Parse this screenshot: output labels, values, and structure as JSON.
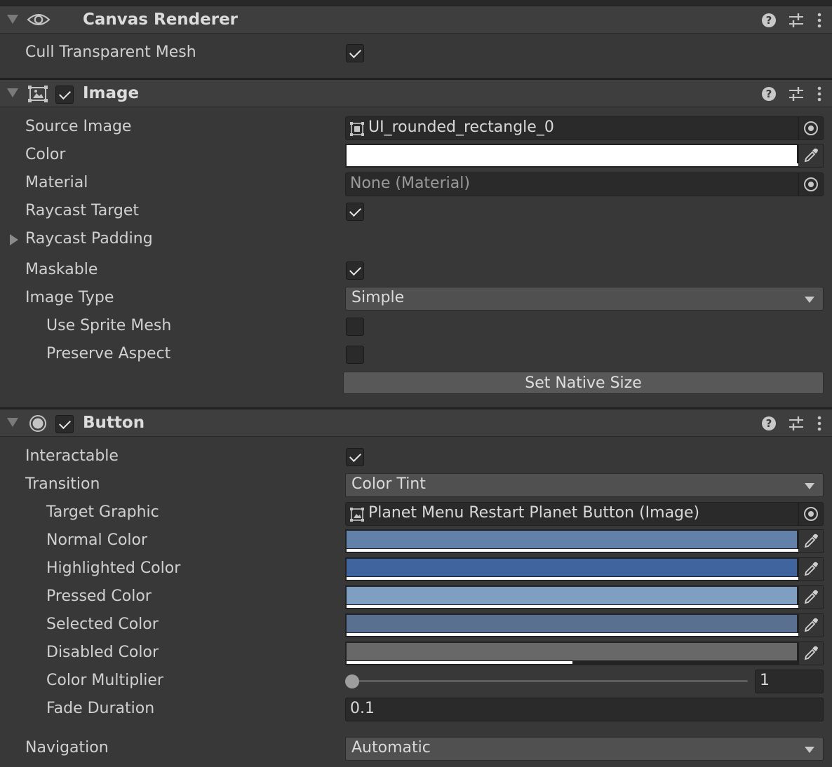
{
  "canvas_renderer": {
    "title": "Canvas Renderer",
    "cull_transparent_mesh": {
      "label": "Cull Transparent Mesh",
      "checked": true
    }
  },
  "image": {
    "title": "Image",
    "enabled": true,
    "source_image": {
      "label": "Source Image",
      "value": "UI_rounded_rectangle_0"
    },
    "color": {
      "label": "Color",
      "hex": "#ffffff"
    },
    "material": {
      "label": "Material",
      "value": "None (Material)"
    },
    "raycast_target": {
      "label": "Raycast Target",
      "checked": true
    },
    "raycast_padding": {
      "label": "Raycast Padding"
    },
    "maskable": {
      "label": "Maskable",
      "checked": true
    },
    "image_type": {
      "label": "Image Type",
      "value": "Simple"
    },
    "use_sprite_mesh": {
      "label": "Use Sprite Mesh",
      "checked": false
    },
    "preserve_aspect": {
      "label": "Preserve Aspect",
      "checked": false
    },
    "set_native_size": {
      "label": "Set Native Size"
    }
  },
  "button": {
    "title": "Button",
    "enabled": true,
    "interactable": {
      "label": "Interactable",
      "checked": true
    },
    "transition": {
      "label": "Transition",
      "value": "Color Tint"
    },
    "target_graphic": {
      "label": "Target Graphic",
      "value": "Planet Menu Restart Planet Button (Image)"
    },
    "normal_color": {
      "label": "Normal Color",
      "hex": "#6181a8",
      "alpha": 1.0
    },
    "highlighted_color": {
      "label": "Highlighted Color",
      "hex": "#3f649e",
      "alpha": 1.0
    },
    "pressed_color": {
      "label": "Pressed Color",
      "hex": "#7f9fc2",
      "alpha": 1.0
    },
    "selected_color": {
      "label": "Selected Color",
      "hex": "#5a7090",
      "alpha": 1.0
    },
    "disabled_color": {
      "label": "Disabled Color",
      "hex": "#686868",
      "alpha": 0.5
    },
    "color_multiplier": {
      "label": "Color Multiplier",
      "value": "1"
    },
    "fade_duration": {
      "label": "Fade Duration",
      "value": "0.1"
    },
    "navigation": {
      "label": "Navigation",
      "value": "Automatic"
    }
  }
}
